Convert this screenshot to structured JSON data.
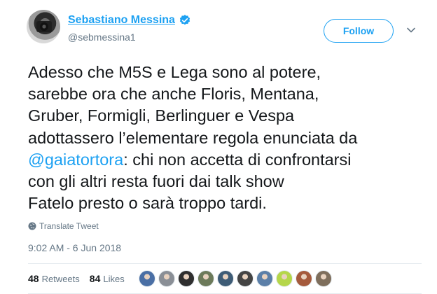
{
  "author": {
    "name": "Sebastiano Messina",
    "handle": "@sebmessina1"
  },
  "header": {
    "follow_label": "Follow"
  },
  "tweet": {
    "text_before": "Adesso che M5S e Lega sono al potere,\nsarebbe ora che anche Floris, Mentana,\nGruber, Formigli, Berlinguer e Vespa\nadottassero l’elementare regola enunciata da\n",
    "mention": "@gaiatortora",
    "text_after": ": chi non accetta di confrontarsi\ncon gli altri resta fuori dai talk show\nFatelo presto o sarà troppo tardi.",
    "translate_label": "Translate Tweet",
    "timestamp": "9:02 AM - 6 Jun 2018"
  },
  "stats": {
    "retweets_count": "48",
    "retweets_label": "Retweets",
    "likes_count": "84",
    "likes_label": "Likes"
  },
  "likers": [
    {
      "color": "#4a6fa5"
    },
    {
      "color": "#8a8f96"
    },
    {
      "color": "#2f2f2f"
    },
    {
      "color": "#6c7a5a"
    },
    {
      "color": "#3e5c76"
    },
    {
      "color": "#444444"
    },
    {
      "color": "#5b7fa8"
    },
    {
      "color": "#b5d64a"
    },
    {
      "color": "#a55a3c"
    },
    {
      "color": "#7e6e5c"
    }
  ],
  "colors": {
    "accent": "#1da1f2",
    "secondary_text": "#657786"
  }
}
